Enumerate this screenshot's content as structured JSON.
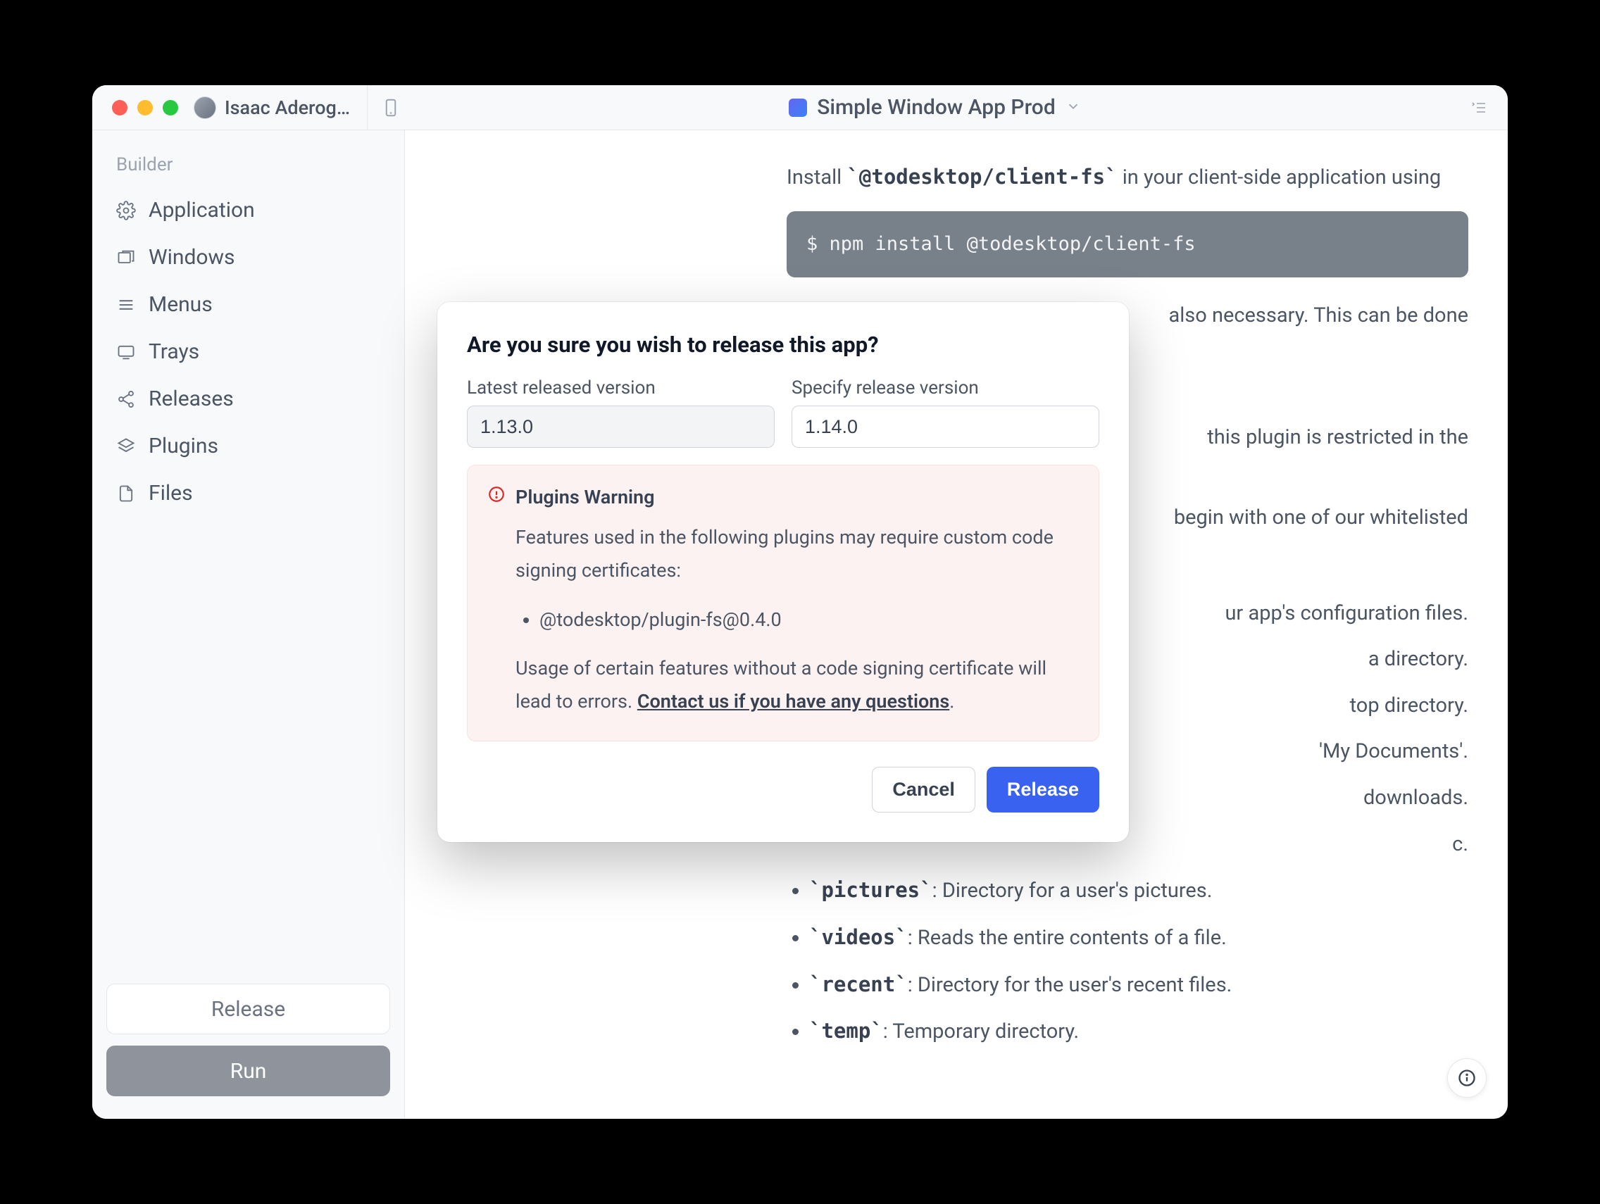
{
  "topbar": {
    "user_name": "Isaac Aderog…",
    "app_name": "Simple Window App Prod"
  },
  "sidebar": {
    "heading": "Builder",
    "items": [
      {
        "label": "Application"
      },
      {
        "label": "Windows"
      },
      {
        "label": "Menus"
      },
      {
        "label": "Trays"
      },
      {
        "label": "Releases"
      },
      {
        "label": "Plugins"
      },
      {
        "label": "Files"
      }
    ],
    "release_label": "Release",
    "run_label": "Run"
  },
  "content": {
    "intro_prefix": "Install ",
    "intro_pkg": "`@todesktop/client-fs`",
    "intro_suffix": " in your client-side application using",
    "code_line": "$ npm install @todesktop/client-fs",
    "snippet_right_1": "also necessary. This can be done",
    "snippet_right_2": "this plugin is restricted in the",
    "snippet_right_3": "begin with one of our whitelisted",
    "snippet_right_4": "ur app's configuration files.",
    "snippet_right_5": "a directory.",
    "snippet_right_6": "top directory.",
    "snippet_right_7": "'My Documents'.",
    "snippet_right_8": "downloads.",
    "snippet_right_9": "c.",
    "list": [
      {
        "code": "`pictures`",
        "text": ": Directory for a user's pictures."
      },
      {
        "code": "`videos`",
        "text": ": Reads the entire contents of a file."
      },
      {
        "code": "`recent`",
        "text": ": Directory for the user's recent files."
      },
      {
        "code": "`temp`",
        "text": ": Temporary directory."
      }
    ]
  },
  "modal": {
    "title": "Are you sure you wish to release this app?",
    "latest_label": "Latest released version",
    "latest_value": "1.13.0",
    "specify_label": "Specify release version",
    "specify_value": "1.14.0",
    "warning_title": "Plugins Warning",
    "warning_p1": "Features used in the following plugins may require custom code signing certificates:",
    "warning_item": "@todesktop/plugin-fs@0.4.0",
    "warning_p2a": "Usage of certain features without a code signing certificate will lead to errors. ",
    "warning_link": "Contact us if you have any questions",
    "warning_p2b": ".",
    "cancel": "Cancel",
    "release": "Release"
  }
}
